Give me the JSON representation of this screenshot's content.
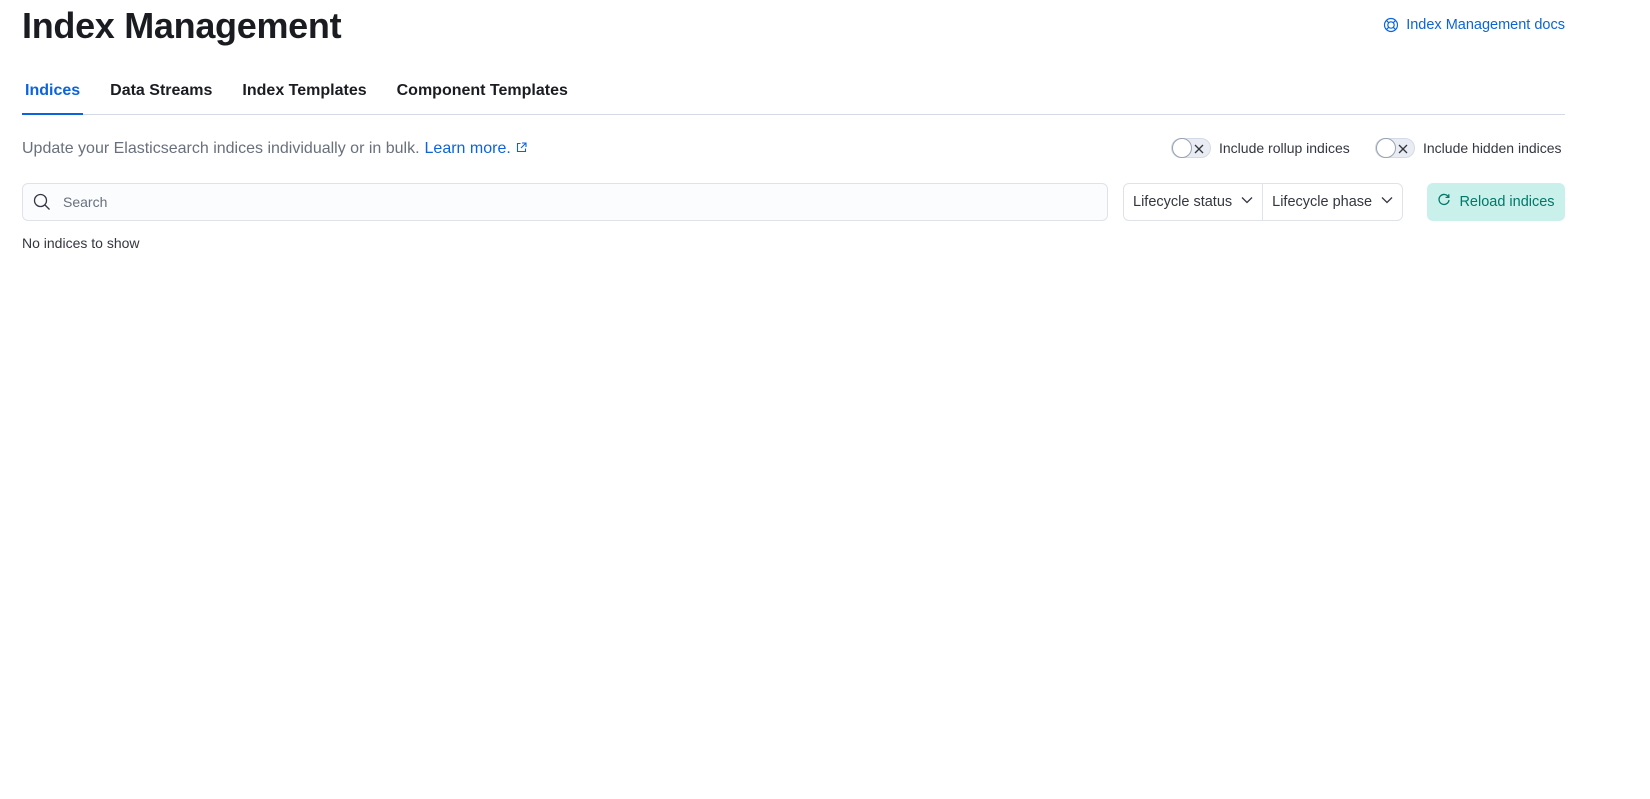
{
  "header": {
    "title": "Index Management",
    "docs_link": "Index Management docs"
  },
  "tabs": [
    {
      "label": "Indices",
      "selected": true
    },
    {
      "label": "Data Streams",
      "selected": false
    },
    {
      "label": "Index Templates",
      "selected": false
    },
    {
      "label": "Component Templates",
      "selected": false
    }
  ],
  "description": {
    "text": "Update your Elasticsearch indices individually or in bulk.",
    "link_label": "Learn more."
  },
  "toggles": {
    "rollup": {
      "label": "Include rollup indices",
      "checked": false
    },
    "hidden": {
      "label": "Include hidden indices",
      "checked": false
    }
  },
  "search": {
    "placeholder": "Search",
    "value": ""
  },
  "filters": {
    "lifecycle_status": "Lifecycle status",
    "lifecycle_phase": "Lifecycle phase"
  },
  "reload_button": {
    "label": "Reload indices"
  },
  "empty_state": "No indices to show",
  "colors": {
    "accent": "#0b64dd",
    "reload_bg": "#c9f0ea",
    "reload_text": "#00786a",
    "muted_text": "#69707d"
  },
  "icons": {
    "docs": "help-lifebuoy-icon",
    "external": "external-link-icon",
    "search": "search-icon",
    "chevron": "chevron-down-icon",
    "reload": "refresh-icon",
    "switch_off": "cross-icon"
  }
}
